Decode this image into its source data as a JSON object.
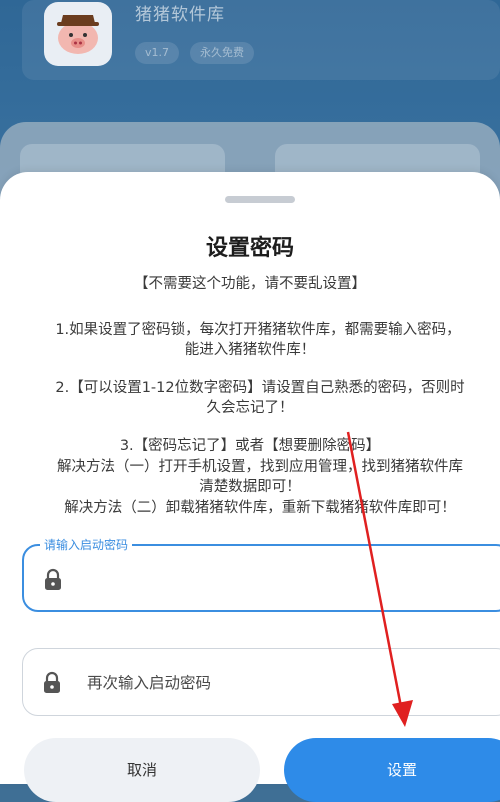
{
  "app": {
    "name": "猪猪软件库",
    "tags": [
      "v1.7",
      "永久免费"
    ]
  },
  "dialog": {
    "title": "设置密码",
    "lines": [
      "【不需要这个功能，请不要乱设置】",
      "1.如果设置了密码锁，每次打开猪猪软件库，都需要输入密码，",
      "能进入猪猪软件库！",
      "2.【可以设置1-12位数字密码】请设置自己熟悉的密码，否则时",
      "久会忘记了！",
      "3.【密码忘记了】或者【想要删除密码】",
      "解决方法（一）打开手机设置，找到应用管理，找到猪猪软件库",
      "清楚数据即可！",
      "解决方法（二）卸载猪猪软件库，重新下载猪猪软件库即可！"
    ],
    "input1": {
      "label": "请输入启动密码"
    },
    "input2": {
      "placeholder": "再次输入启动密码"
    },
    "cancel_label": "取消",
    "confirm_label": "设置"
  },
  "colors": {
    "accent": "#2e8be8",
    "annotation_arrow": "#e02020"
  },
  "icons": {
    "app": "pig-icon",
    "lock": "lock-icon"
  }
}
